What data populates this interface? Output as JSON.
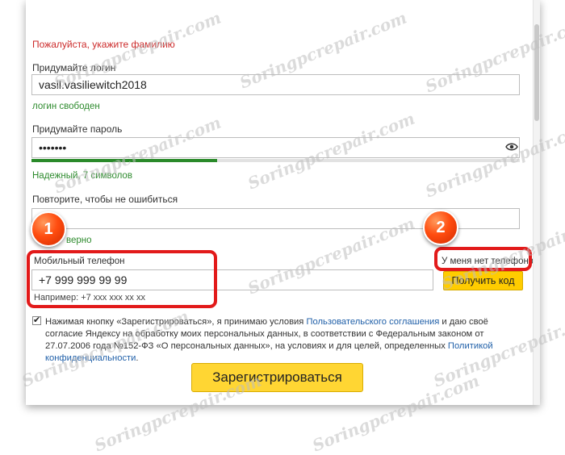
{
  "form": {
    "surname_error": "Пожалуйста, укажите фамилию",
    "login_label": "Придумайте логин",
    "login_value": "vasil.vasiliewitch2018",
    "login_status": "логин свободен",
    "password_label": "Придумайте пароль",
    "password_value": "•••••••",
    "password_strength_text": "Надежный, 7 символов",
    "password_strength_level": 0.38,
    "repeat_label": "Повторите, чтобы не ошибиться",
    "repeat_status": "верно",
    "phone_label": "Мобильный телефон",
    "phone_value": "+7 999 999 99 99",
    "phone_hint": "Например: +7 xxx xxx xx xx",
    "no_phone_label": "У меня нет телефона",
    "get_code_label": "Получить код",
    "agreement": {
      "checked": true,
      "part1": "Нажимая кнопку «Зарегистрироваться», я принимаю условия ",
      "link1": "Пользовательского соглашения",
      "part2": " и даю своё согласие Яндексу на обработку моих персональных данных, в соответствии с Федеральным законом от 27.07.2006 года №152-ФЗ «О персональных данных», на условиях и для целей, определенных ",
      "link2": "Политикой конфиденциальности",
      "part3": "."
    },
    "register_label": "Зарегистрироваться"
  },
  "annotations": {
    "marker1": "1",
    "marker2": "2"
  },
  "watermark": "Soringpcrepair.com",
  "colors": {
    "error": "#cc2a2a",
    "success": "#2e8b2e",
    "link": "#1f5fa8",
    "accent_button": "#ffcc00",
    "highlight": "#e21a1a"
  },
  "icons": {
    "eye": "eye-icon",
    "check": "checkmark-icon"
  }
}
